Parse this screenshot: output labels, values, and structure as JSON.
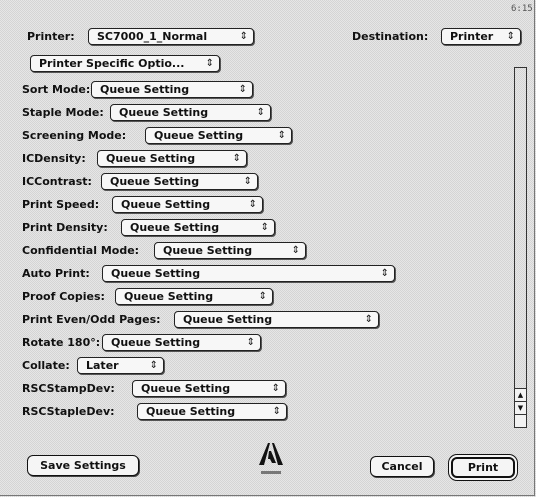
{
  "corner_text": "6:15",
  "header": {
    "printer_label": "Printer:",
    "printer_value": "SC7000_1_Normal",
    "destination_label": "Destination:",
    "destination_value": "Printer",
    "panel_value": "Printer Specific Optio..."
  },
  "options": [
    {
      "label": "Sort Mode:",
      "value": "Queue Setting"
    },
    {
      "label": "Staple Mode:",
      "value": "Queue Setting"
    },
    {
      "label": "Screening Mode:",
      "value": "Queue Setting"
    },
    {
      "label": "ICDensity:",
      "value": "Queue Setting"
    },
    {
      "label": "ICContrast:",
      "value": "Queue Setting"
    },
    {
      "label": "Print Speed:",
      "value": "Queue Setting"
    },
    {
      "label": "Print Density:",
      "value": "Queue Setting"
    },
    {
      "label": "Confidential Mode:",
      "value": "Queue Setting"
    },
    {
      "label": "Auto Print:",
      "value": "Queue Setting"
    },
    {
      "label": "Proof Copies:",
      "value": "Queue Setting"
    },
    {
      "label": "Print Even/Odd Pages:",
      "value": "Queue Setting"
    },
    {
      "label": "Rotate 180°:",
      "value": "Queue Setting"
    },
    {
      "label": "Collate:",
      "value": "Later"
    },
    {
      "label": "RSCStampDev:",
      "value": "Queue Setting"
    },
    {
      "label": "RSCStapleDev:",
      "value": "Queue Setting"
    }
  ],
  "popup_arrow": "⇕",
  "scroll_up": "▲",
  "scroll_down": "▼",
  "buttons": {
    "save": "Save Settings",
    "cancel": "Cancel",
    "print": "Print"
  },
  "logo_text": "Adobe",
  "colors": {
    "window_bg": "#d4d4d4",
    "control_bg": "#f7f7f7",
    "border": "#222222"
  }
}
